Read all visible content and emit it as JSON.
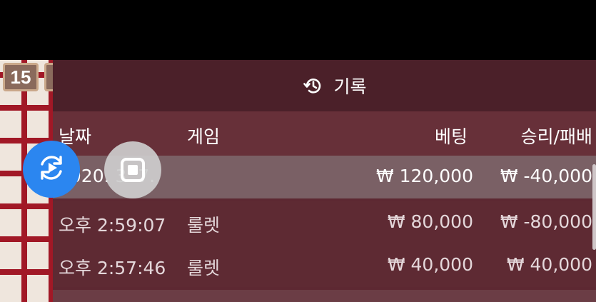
{
  "game_badge": {
    "number": "15"
  },
  "history_panel": {
    "title": "기록",
    "icon": "history-icon",
    "columns": {
      "date": "날짜",
      "game": "게임",
      "bet": "베팅",
      "win_loss": "승리/패배"
    },
    "rows": [
      {
        "date": "2020. 3. 7.",
        "game": "",
        "bet": "₩ 120,000",
        "win_loss": "₩ -40,000"
      },
      {
        "date": "오후 2:59:07",
        "game": "룰렛",
        "bet": "₩ 80,000",
        "win_loss": "₩ -80,000"
      },
      {
        "date": "오후 2:57:46",
        "game": "룰렛",
        "bet": "₩ 40,000",
        "win_loss": "₩ 40,000"
      }
    ]
  },
  "floating_buttons": {
    "refresh": {
      "icon": "refresh-play-icon",
      "color": "#2b86f0"
    },
    "stop": {
      "icon": "stop-icon"
    }
  },
  "colors": {
    "panel_bg": "#5d2832",
    "header_bg": "#4b2029",
    "accent": "#2b86f0"
  }
}
